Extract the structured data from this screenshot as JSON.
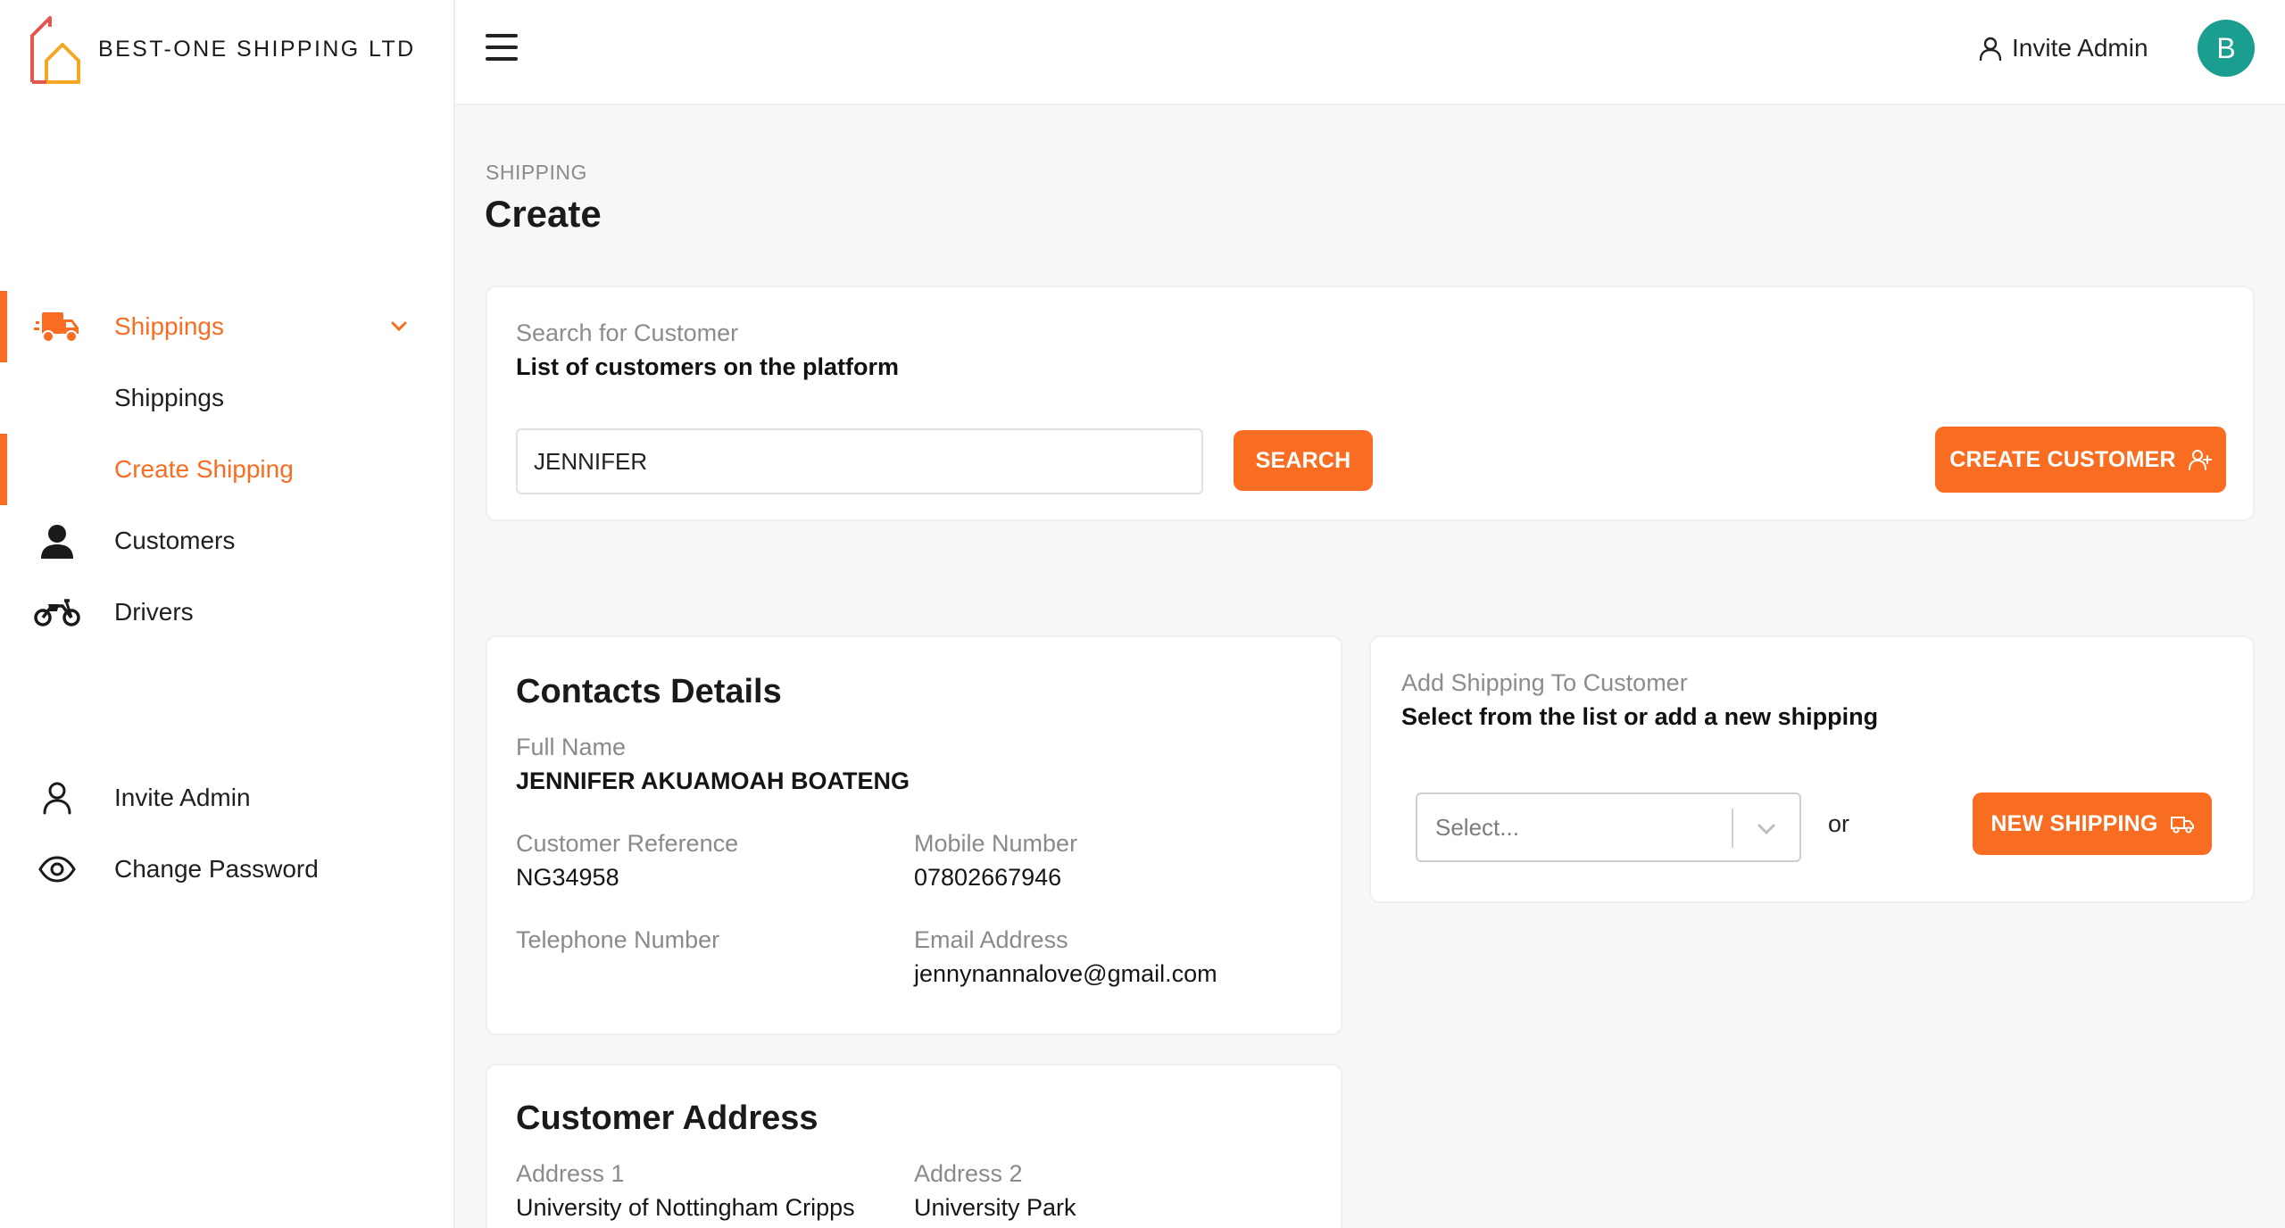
{
  "brand": {
    "name": "BEST-ONE SHIPPING LTD",
    "logo_icon": "house-logo-icon"
  },
  "sidebar": {
    "items": [
      {
        "label": "Shippings",
        "icon": "delivery-truck-icon",
        "active": true,
        "expanded": true
      },
      {
        "label": "Shippings",
        "icon": "",
        "active": false
      },
      {
        "label": "Create Shipping",
        "icon": "",
        "active": true
      },
      {
        "label": "Customers",
        "icon": "person-icon",
        "active": false
      },
      {
        "label": "Drivers",
        "icon": "motorcycle-icon",
        "active": false
      },
      {
        "label": "Invite Admin",
        "icon": "user-outline-icon",
        "active": false
      },
      {
        "label": "Change Password",
        "icon": "eye-icon",
        "active": false
      }
    ]
  },
  "topbar": {
    "invite_label": "Invite Admin",
    "avatar_initial": "B",
    "avatar_color": "#1a9e8f"
  },
  "page": {
    "breadcrumb": "SHIPPING",
    "title": "Create"
  },
  "search": {
    "heading": "Search for Customer",
    "subheading": "List of customers on the platform",
    "input_value": "JENNIFER",
    "search_button": "SEARCH",
    "create_button": "CREATE CUSTOMER"
  },
  "contacts": {
    "title": "Contacts Details",
    "full_name_label": "Full Name",
    "full_name": "JENNIFER AKUAMOAH BOATENG",
    "customer_ref_label": "Customer Reference",
    "customer_ref": "NG34958",
    "mobile_label": "Mobile Number",
    "mobile": "07802667946",
    "telephone_label": "Telephone Number",
    "telephone": "",
    "email_label": "Email Address",
    "email": "jennynannalove@gmail.com"
  },
  "add_shipping": {
    "heading": "Add Shipping To Customer",
    "subheading": "Select from the list or add a new shipping",
    "select_placeholder": "Select...",
    "or_text": "or",
    "new_button": "NEW SHIPPING"
  },
  "address": {
    "title": "Customer Address",
    "address1_label": "Address 1",
    "address1": "University of Nottingham Cripps",
    "address2_label": "Address 2",
    "address2": "University Park"
  },
  "colors": {
    "accent": "#f86d21",
    "avatar": "#1a9e8f"
  }
}
